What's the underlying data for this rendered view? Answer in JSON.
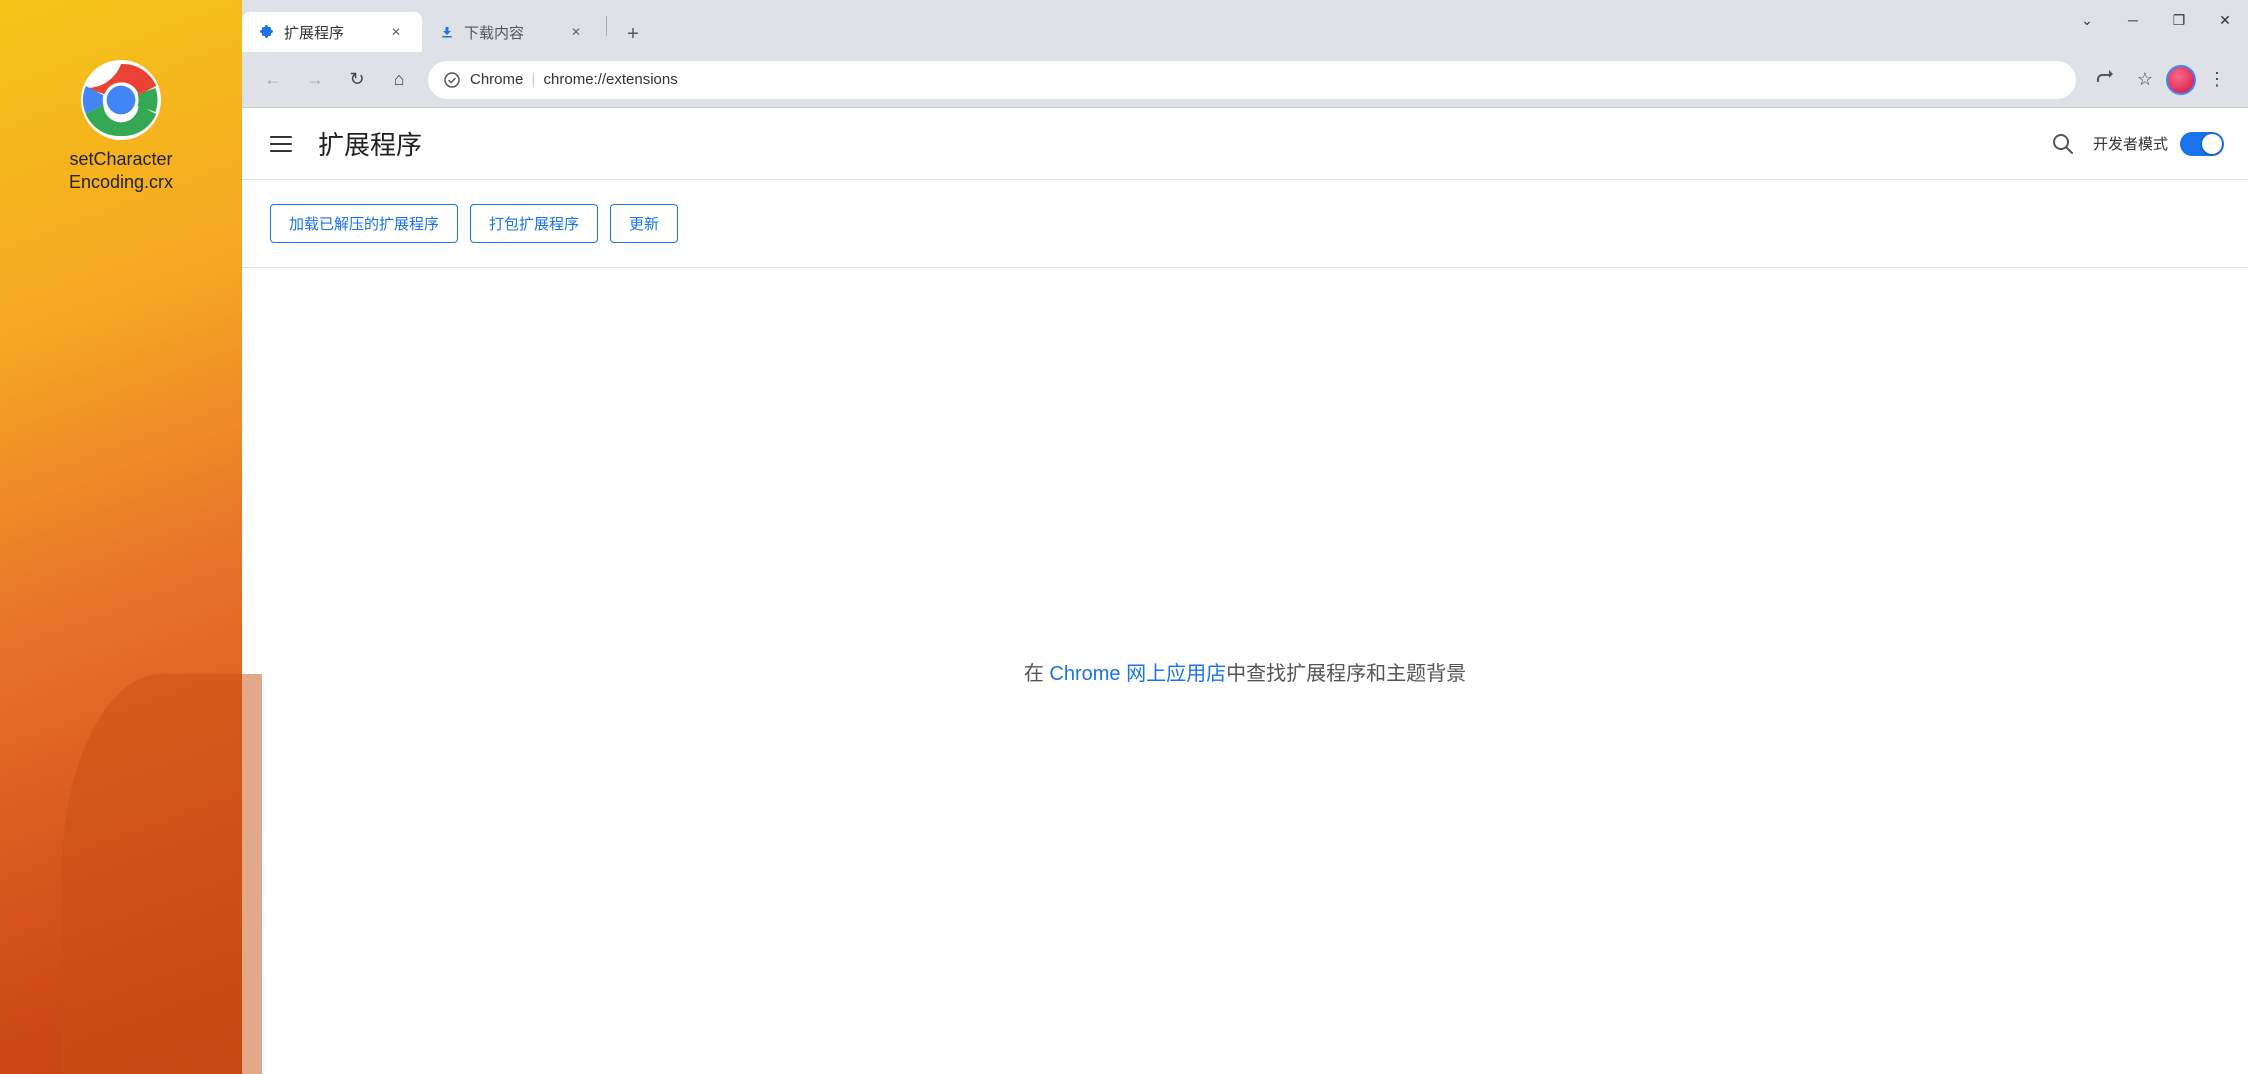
{
  "desktop": {
    "icon_label": "setCharacter\nEncoding.crx"
  },
  "window": {
    "controls": {
      "minimize_label": "─",
      "restore_label": "❐",
      "close_label": "✕",
      "arrow_label": "⌄"
    }
  },
  "tabs": [
    {
      "id": "tab-extensions",
      "icon": "puzzle",
      "label": "扩展程序",
      "active": true
    },
    {
      "id": "tab-downloads",
      "icon": "download",
      "label": "下载内容",
      "active": false
    }
  ],
  "new_tab_label": "+",
  "toolbar": {
    "back_label": "←",
    "forward_label": "→",
    "reload_label": "↻",
    "home_label": "⌂",
    "security_label": "🔒",
    "url_prefix": "Chrome",
    "url_separator": "|",
    "url_path": "chrome://extensions",
    "share_label": "⬆",
    "bookmark_label": "☆",
    "more_label": "⋮"
  },
  "page": {
    "title": "扩展程序",
    "search_label": "🔍",
    "dev_mode_label": "开发者模式",
    "actions": [
      {
        "id": "load-unpacked",
        "label": "加载已解压的扩展程序"
      },
      {
        "id": "pack-extension",
        "label": "打包扩展程序"
      },
      {
        "id": "update",
        "label": "更新"
      }
    ],
    "empty_text_before": "在 ",
    "empty_link": "Chrome 网上应用店",
    "empty_text_after": "中查找扩展程序和主题背景"
  }
}
